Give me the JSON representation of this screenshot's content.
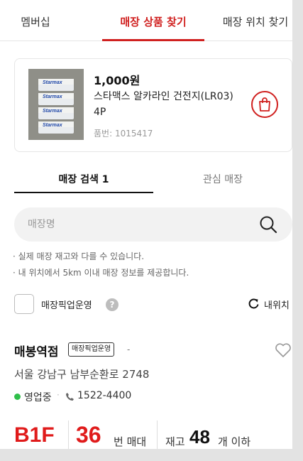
{
  "top_tabs": [
    {
      "label": "멤버십",
      "active": false
    },
    {
      "label": "매장 상품 찾기",
      "active": true
    },
    {
      "label": "매장 위치 찾기",
      "active": false
    }
  ],
  "product": {
    "price": "1,000원",
    "name": "스타맥스 알카라인 건전지(LR03) 4P",
    "code": "품번: 1015417",
    "thumb_brand": "Starmax",
    "thumb_icon": "battery-pack-image"
  },
  "store_tabs": [
    {
      "label": "매장 검색 1",
      "active": true
    },
    {
      "label": "관심 매장",
      "active": false
    }
  ],
  "search": {
    "placeholder": "매장명",
    "value": ""
  },
  "notes": [
    "· 실제 매장 재고와 다를 수 있습니다.",
    "· 내 위치에서 5km 이내 매장 정보를 제공합니다."
  ],
  "pickup": {
    "label": "매장픽업운영",
    "checked": false,
    "help": "?"
  },
  "my_location": {
    "label": "내위치"
  },
  "store": {
    "name": "매봉역점",
    "badge": "매장픽업운영",
    "dash": "-",
    "address": "서울 강남구 남부순환로 2748",
    "status": "영업중",
    "status_color": "#2fbf4a",
    "separator": "·",
    "phone": "1522-4400",
    "floor": "B1F",
    "bay_number": "36",
    "bay_unit": "번 매대",
    "stock_label": "재고",
    "stock_count": "48",
    "stock_unit": "개 이하"
  },
  "colors": {
    "accent": "#d0201f",
    "highlight": "#e01b1b"
  }
}
